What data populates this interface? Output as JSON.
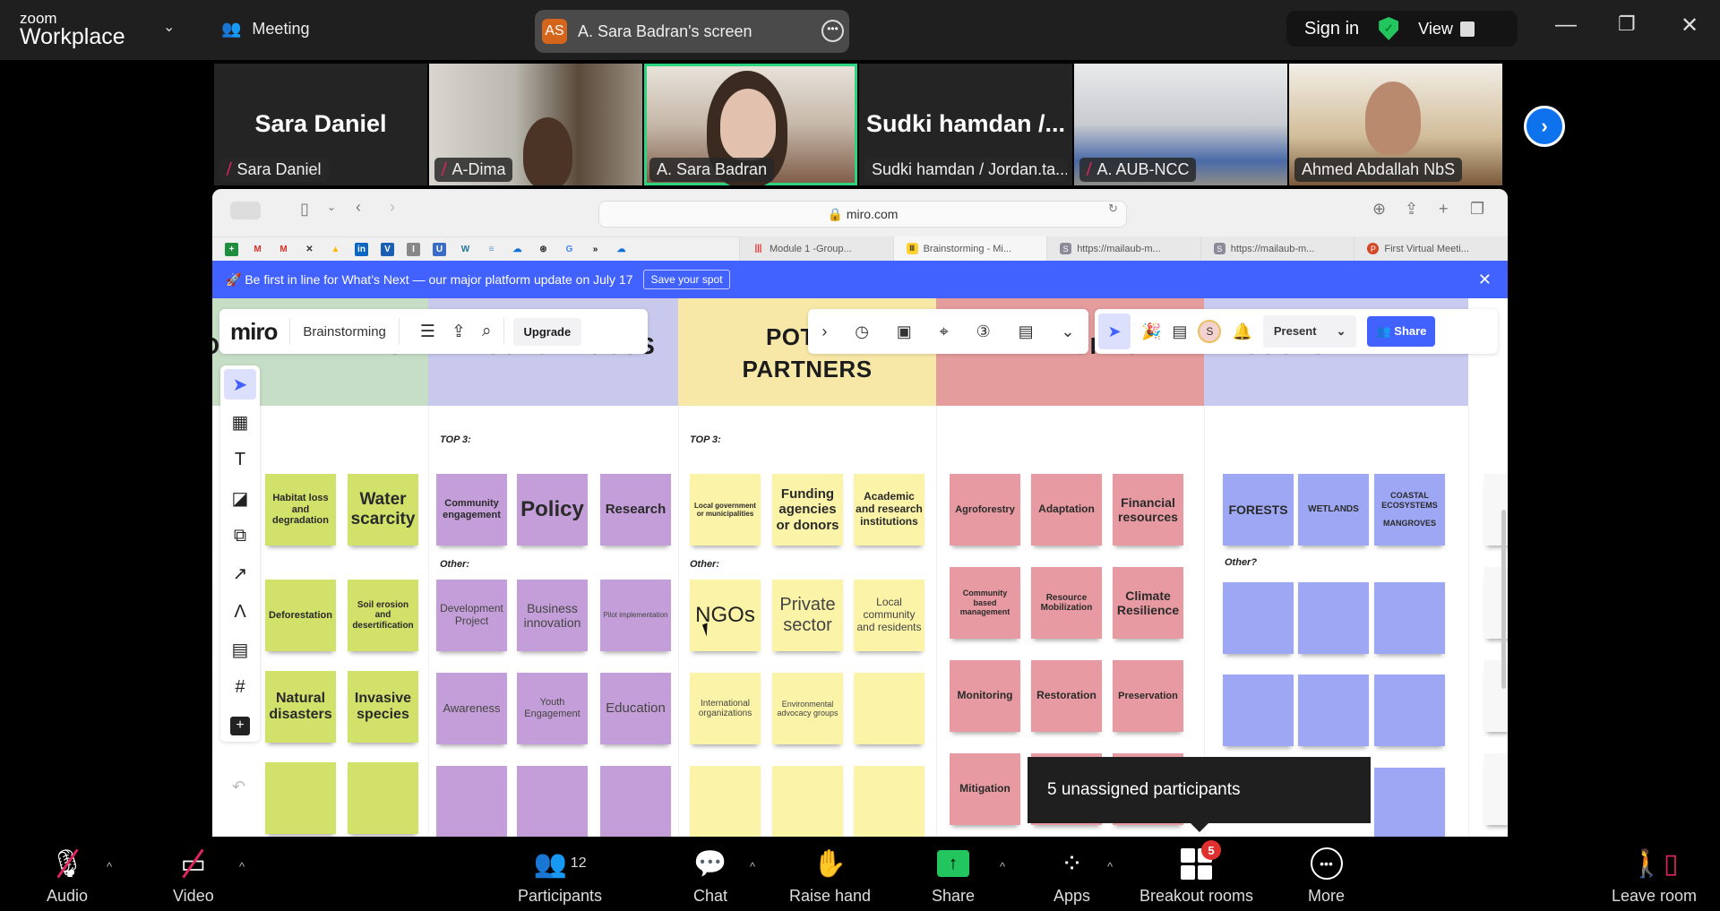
{
  "app": {
    "logo_small": "zoom",
    "logo_big": "Workplace",
    "meeting_label": "Meeting",
    "screen_owner_initials": "AS",
    "screen_owner_label": "A. Sara Badran's screen",
    "sign_in": "Sign in",
    "view_label": "View",
    "colors": {
      "active_speaker": "#2dd47e",
      "accent_blue": "#0e72ed",
      "mute_red": "#e0245e",
      "share_green": "#22c55e"
    }
  },
  "gallery": [
    {
      "big_name": "Sara Daniel",
      "caption": "Sara Daniel",
      "muted": true,
      "video": false
    },
    {
      "caption": "A-Dima",
      "muted": true,
      "video": true
    },
    {
      "caption": "A. Sara Badran",
      "muted": false,
      "video": true,
      "active_speaker": true
    },
    {
      "big_name": "Sudki  hamdan /...",
      "caption": "Sudki hamdan / Jordan.ta...",
      "muted": false,
      "video": false
    },
    {
      "caption": "A. AUB-NCC",
      "muted": true,
      "video": true
    },
    {
      "caption": "Ahmed Abdallah NbS",
      "muted": false,
      "video": true
    }
  ],
  "browser": {
    "url": "miro.com",
    "tabs": [
      {
        "label": "Module 1 -Group...",
        "icon": "miro-icon"
      },
      {
        "label": "Brainstorming - Mi...",
        "icon": "miro-icon",
        "active": true
      },
      {
        "label": "https://mailaub-m...",
        "icon": "s-icon"
      },
      {
        "label": "https://mailaub-m...",
        "icon": "s-icon"
      },
      {
        "label": "First Virtual Meeti...",
        "icon": "powerpoint-icon"
      }
    ],
    "bookmarks": [
      "sheets",
      "gmail",
      "gmail",
      "bookmark",
      "drive",
      "linkedin",
      "vimeo",
      "bookmark",
      "un-obs",
      "wordpress",
      "bookmark",
      "onedrive",
      "openai",
      "google",
      "more",
      "onedrive"
    ]
  },
  "miro": {
    "banner_text": "🚀 Be first in line for What’s Next — our major platform update on July 17",
    "banner_button": "Save your spot",
    "logo": "miro",
    "board_name": "Brainstorming",
    "upgrade": "Upgrade",
    "present": "Present",
    "share": "Share",
    "avatar_initial": "S",
    "columns": [
      {
        "title": "OTHER THREATS"
      },
      {
        "title": "PROJECT FOCUS",
        "top_label": "TOP 3:",
        "other_label": "Other:"
      },
      {
        "title": "POTENTIAL PARTNERS",
        "title_visible_1": "POTEN",
        "title_visible_2": "PARTNERS",
        "top_label": "TOP 3:",
        "other_label": "Other:"
      },
      {
        "title": "KEYWORDS"
      },
      {
        "title": "ECOSYSTEM TYPE",
        "other_label": "Other?"
      }
    ],
    "notes": {
      "threats": [
        "Habitat loss and degradation",
        "Water scarcity",
        "Deforestation",
        "Soil erosion and desertification",
        "Natural disasters",
        "Invasive species",
        "",
        ""
      ],
      "focus_top": [
        "Community engagement",
        "Policy",
        "Research"
      ],
      "focus_other": [
        "Development Project",
        "Business innovation",
        "Pilot implementation",
        "Awareness",
        "Youth Engagement",
        "Education",
        "",
        "",
        ""
      ],
      "partners_top": [
        "Local government or municipalities",
        "Funding agencies or donors",
        "Academic and research institutions"
      ],
      "partners_other": [
        "NGOs",
        "Private sector",
        "Local community and residents",
        "International organizations",
        "Environmental advocacy groups",
        "",
        "",
        "",
        ""
      ],
      "keywords": [
        "Agroforestry",
        "Adaptation",
        "Financial resources",
        "Community based management",
        "Resource Mobilization",
        "Climate Resilience",
        "Monitoring",
        "Restoration",
        "Preservation",
        "Mitigation"
      ],
      "ecosystem_top": [
        "FORESTS",
        "WETLANDS",
        "COASTAL ECOSYSTEMS\n\nMANGROVES"
      ]
    }
  },
  "tooltip": "5 unassigned participants",
  "controls": {
    "audio": "Audio",
    "video": "Video",
    "participants": "Participants",
    "participants_count": "12",
    "chat": "Chat",
    "raise_hand": "Raise hand",
    "share": "Share",
    "apps": "Apps",
    "breakout": "Breakout rooms",
    "breakout_badge": "5",
    "more": "More",
    "leave": "Leave room"
  }
}
